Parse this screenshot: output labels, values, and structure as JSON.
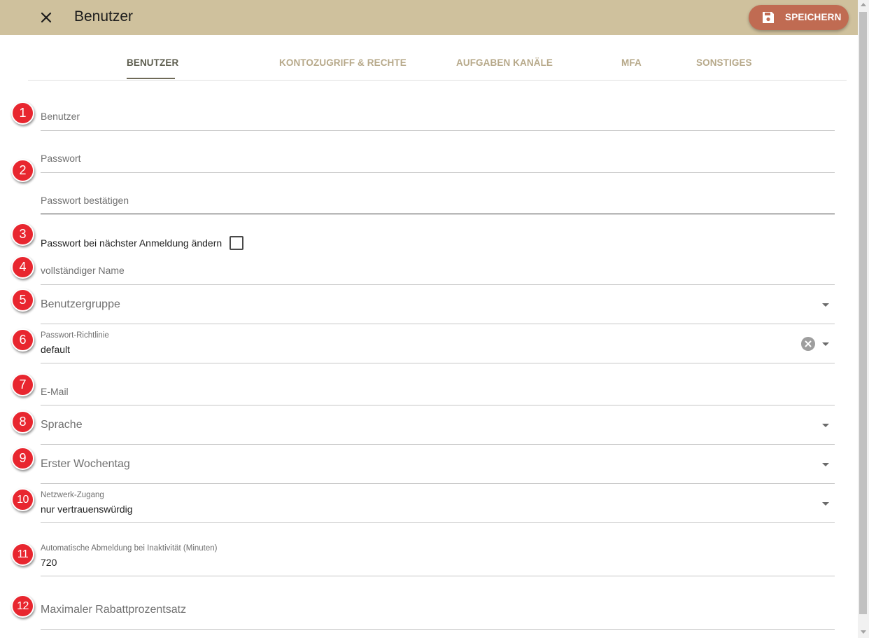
{
  "header": {
    "title": "Benutzer",
    "save_label": "SPEICHERN",
    "background": "#cfc19d",
    "save_color": "#c06b52"
  },
  "tabs": [
    {
      "label": "BENUTZER",
      "active": true
    },
    {
      "label": "KONTOZUGRIFF & RECHTE",
      "active": false
    },
    {
      "label": "AUFGABEN KANÄLE",
      "active": false
    },
    {
      "label": "MFA",
      "active": false
    },
    {
      "label": "SONSTIGES",
      "active": false
    }
  ],
  "form": {
    "username": {
      "placeholder": "Benutzer"
    },
    "password": {
      "placeholder": "Passwort"
    },
    "password_confirm": {
      "placeholder": "Passwort bestätigen"
    },
    "change_password_next_login": {
      "label": "Passwort bei nächster Anmeldung ändern",
      "checked": false
    },
    "full_name": {
      "placeholder": "vollständiger Name"
    },
    "user_group": {
      "placeholder": "Benutzergruppe"
    },
    "password_policy": {
      "label": "Passwort-Richtlinie",
      "value": "default"
    },
    "email": {
      "placeholder": "E-Mail"
    },
    "language": {
      "placeholder": "Sprache"
    },
    "first_weekday": {
      "placeholder": "Erster Wochentag"
    },
    "network_access": {
      "label": "Netzwerk-Zugang",
      "value": "nur vertrauenswürdig"
    },
    "auto_logout": {
      "label": "Automatische Abmeldung bei Inaktivität (Minuten)",
      "value": "720"
    },
    "max_discount": {
      "placeholder": "Maximaler Rabattprozentsatz"
    }
  },
  "markers": [
    "1",
    "2",
    "3",
    "4",
    "5",
    "6",
    "7",
    "8",
    "9",
    "10",
    "11",
    "12"
  ],
  "icons": {
    "close": "close-icon",
    "save": "floppy-disk-icon",
    "clear": "clear-circle-icon",
    "dropdown": "triangle-down-icon"
  }
}
